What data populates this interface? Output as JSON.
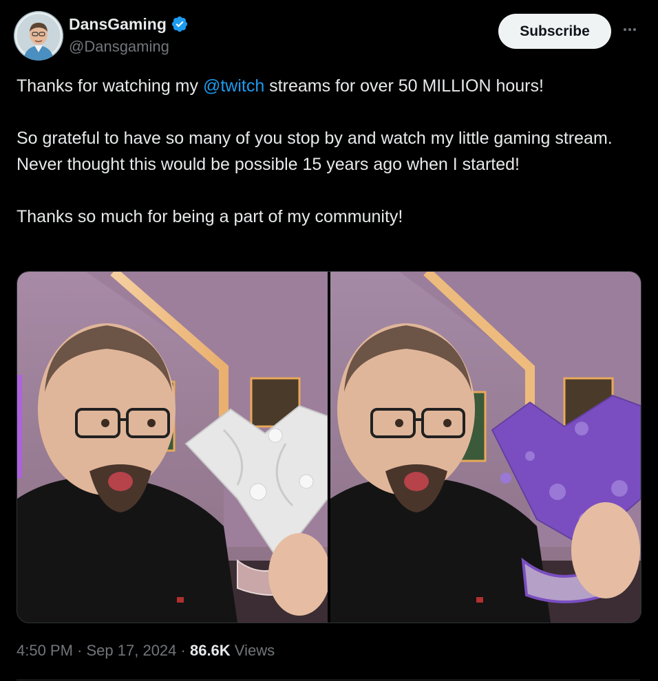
{
  "author": {
    "display_name": "DansGaming",
    "handle": "@Dansgaming",
    "verified": true,
    "verified_badge_icon": "verified-badge-icon",
    "avatar_icon": "avatar-photo"
  },
  "header": {
    "subscribe_label": "Subscribe",
    "more_icon": "more-horizontal-icon"
  },
  "tweet": {
    "line1_before": "Thanks for watching my ",
    "line1_mention": "@twitch",
    "line1_after": " streams for over 50 MILLION hours!",
    "paragraph2": "So grateful to have so many of you stop by and watch my little gaming stream. Never thought this would be possible 15 years ago when I started!",
    "paragraph3": "Thanks so much for being a part of my community!"
  },
  "media": {
    "photos": [
      {
        "subject": "man holding white marble heart-shaped award"
      },
      {
        "subject": "man holding purple heart-shaped award"
      }
    ]
  },
  "meta": {
    "time": "4:50 PM",
    "separator1": " · ",
    "date": "Sep 17, 2024",
    "separator2": " · ",
    "views_count": "86.6K",
    "views_label": " Views"
  },
  "colors": {
    "background": "#000000",
    "text_primary": "#e7e9ea",
    "text_secondary": "#71767b",
    "link": "#1d9bf0",
    "verified": "#1d9bf0",
    "subscribe_bg": "#eff3f4"
  }
}
